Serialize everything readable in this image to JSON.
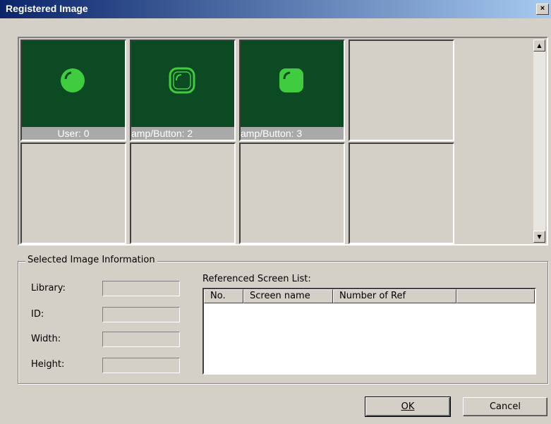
{
  "window": {
    "title": "Registered Image",
    "close_glyph": "×"
  },
  "gallery": {
    "cells": [
      {
        "caption": "User: 0",
        "icon": "green-lamp-solid-circle-icon"
      },
      {
        "caption": "amp/Button: 2",
        "icon": "green-outline-rounded-square-icon"
      },
      {
        "caption": "amp/Button: 3",
        "icon": "green-solid-rounded-square-icon"
      },
      {
        "caption": "",
        "icon": ""
      },
      {
        "caption": "",
        "icon": ""
      },
      {
        "caption": "",
        "icon": ""
      },
      {
        "caption": "",
        "icon": ""
      },
      {
        "caption": "",
        "icon": ""
      }
    ],
    "scroll_up": "▲",
    "scroll_down": "▼"
  },
  "info": {
    "group_title": "Selected Image Information",
    "labels": {
      "library": "Library:",
      "id": "ID:",
      "width": "Width:",
      "height": "Height:"
    },
    "values": {
      "library": "",
      "id": "",
      "width": "",
      "height": ""
    },
    "ref_list_title": "Referenced Screen List:",
    "columns": [
      "No.",
      "Screen name",
      "Number of Ref"
    ]
  },
  "buttons": {
    "ok": "OK",
    "cancel": "Cancel"
  },
  "colors": {
    "cell_bg": "#0b4a22",
    "icon_green": "#3fcc3f",
    "caption_bg": "#a9a9a9",
    "face": "#d4d0c8"
  }
}
